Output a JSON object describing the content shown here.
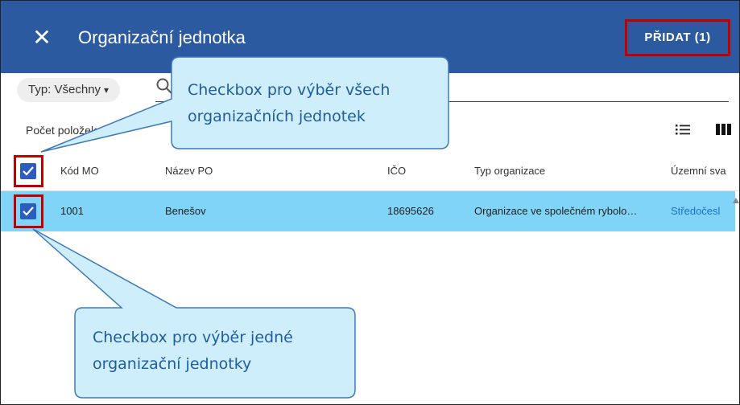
{
  "dialog": {
    "close_icon": "close-icon",
    "title": "Organizační jednotka",
    "add_button": "PŘIDAT (1)"
  },
  "toolbar": {
    "filter_label": "Typ: Všechny",
    "search_icon": "search-icon",
    "count_label": "Počet položek: 1",
    "list_view_icon": "list-view-icon",
    "column_view_icon": "column-view-icon"
  },
  "table": {
    "columns": [
      "Kód MO",
      "Název PO",
      "IČO",
      "Typ organizace",
      "Územní sva"
    ],
    "rows": [
      {
        "selected": true,
        "kod_mo": "1001",
        "nazev_po": "Benešov",
        "ico": "18695626",
        "typ_organizace": "Organizace ve společném rybolo…",
        "uzemni_svaz": "Středočesl"
      }
    ]
  },
  "callouts": {
    "select_all": {
      "line1": "Checkbox pro výběr všech",
      "line2": "organizačních jednotek"
    },
    "select_one": {
      "line1": "Checkbox pro výběr jedné",
      "line2": "organizační jednotky"
    }
  },
  "colors": {
    "header": "#2c5aa0",
    "selected_row": "#80d4f7",
    "checkbox": "#2d5cc0",
    "highlight_border": "#c00000",
    "callout_fill": "#cfeefb",
    "callout_stroke": "#3f79b8"
  }
}
